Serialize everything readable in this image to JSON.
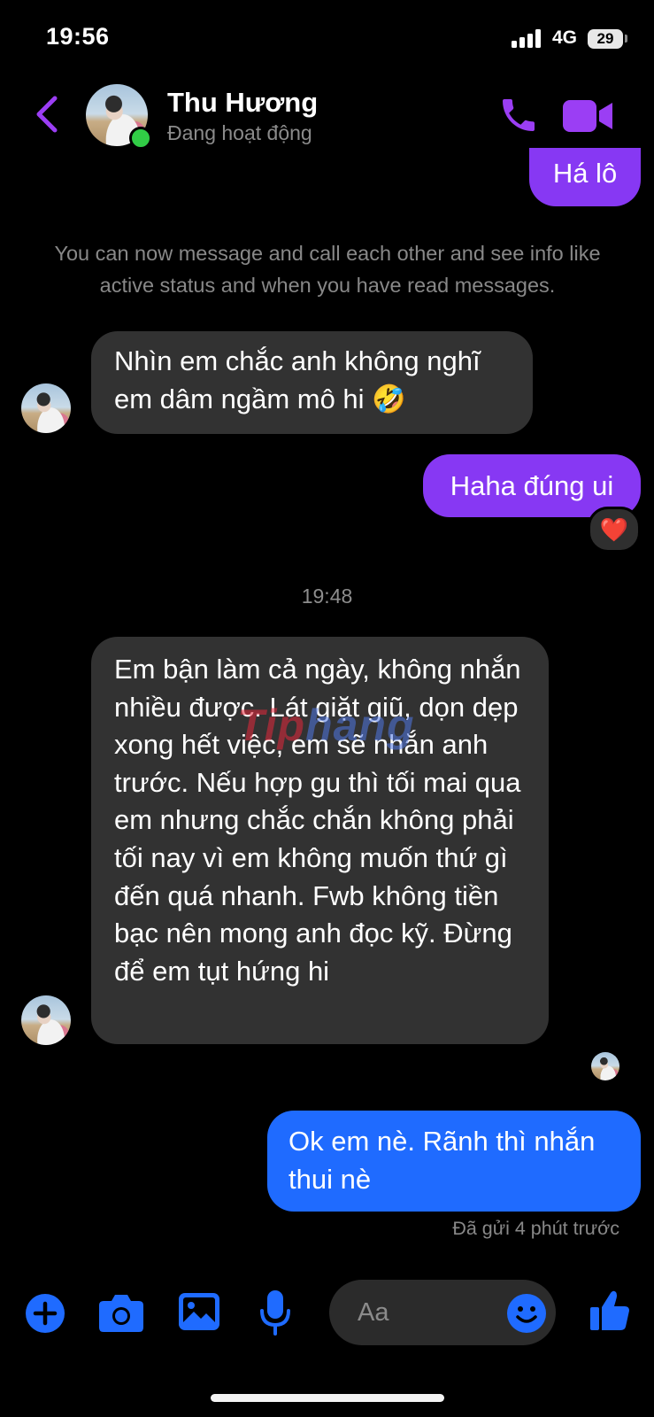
{
  "status_bar": {
    "time": "19:56",
    "network": "4G",
    "battery": "29"
  },
  "header": {
    "contact_name": "Thu Hương",
    "contact_status": "Đang hoạt động"
  },
  "messages": {
    "partial_top": "Há lô",
    "system_notice": "You can now message and call each other and see info like active status and when you have read messages.",
    "incoming_1": "Nhìn em chắc anh không nghĩ em dâm ngầm mô hi 🤣",
    "outgoing_1": "Haha đúng ui",
    "reaction_1": "❤️",
    "timestamp": "19:48",
    "incoming_2": "Em bận làm cả ngày, không nhắn nhiều được. Lát giặt giũ, dọn dẹp xong hết việc, em sẽ nhắn anh trước. Nếu hợp gu thì tối mai qua em nhưng chắc chắn không phải tối nay vì em không muốn thứ gì đến quá nhanh. Fwb không tiền bạc nên mong anh đọc kỹ. Đừng để em tụt hứng hi",
    "watermark_a": "Tip",
    "watermark_b": "hang",
    "outgoing_2": "Ok em nè. Rãnh thì nhắn thui nè",
    "sent_status": "Đã gửi 4 phút trước"
  },
  "composer": {
    "placeholder": "Aa"
  },
  "icons": {
    "back": "chevron-left-icon",
    "call": "phone-icon",
    "video": "video-camera-icon",
    "plus": "plus-circle-icon",
    "camera": "camera-icon",
    "image": "image-icon",
    "mic": "microphone-icon",
    "emoji": "smiley-icon",
    "like": "thumbs-up-icon"
  },
  "colors": {
    "accent_purple": "#8738f3",
    "accent_blue": "#1f6bff",
    "online": "#31cc46"
  }
}
